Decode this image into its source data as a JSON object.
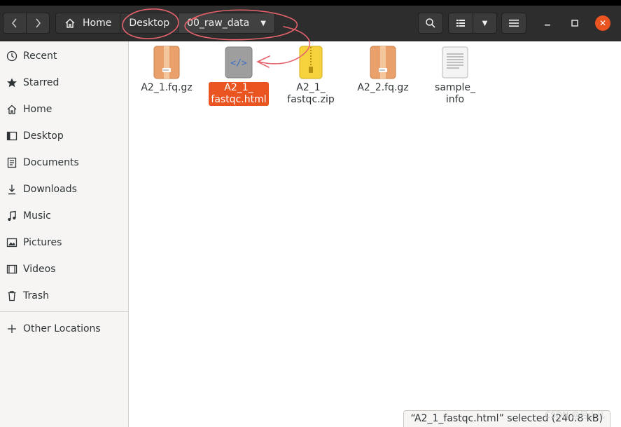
{
  "window": {
    "path": [
      {
        "label": "Home",
        "icon": "home-icon"
      },
      {
        "label": "Desktop"
      },
      {
        "label": "00_raw_data"
      }
    ]
  },
  "sidebar": {
    "items": [
      {
        "label": "Recent",
        "icon": "clock-icon"
      },
      {
        "label": "Starred",
        "icon": "star-icon"
      },
      {
        "label": "Home",
        "icon": "home-icon"
      },
      {
        "label": "Desktop",
        "icon": "desktop-icon"
      },
      {
        "label": "Documents",
        "icon": "document-icon"
      },
      {
        "label": "Downloads",
        "icon": "download-icon"
      },
      {
        "label": "Music",
        "icon": "music-icon"
      },
      {
        "label": "Pictures",
        "icon": "picture-icon"
      },
      {
        "label": "Videos",
        "icon": "video-icon"
      },
      {
        "label": "Trash",
        "icon": "trash-icon"
      }
    ],
    "other_locations": "Other Locations"
  },
  "files": [
    {
      "name": "A2_1.fq.gz",
      "icon": "archive-icon"
    },
    {
      "name": "A2_1_\nfastqc.html",
      "icon": "html-file-icon",
      "selected": true
    },
    {
      "name": "A2_1_\nfastqc.zip",
      "icon": "zip-icon"
    },
    {
      "name": "A2_2.fq.gz",
      "icon": "archive-icon"
    },
    {
      "name": "sample_\ninfo",
      "icon": "text-file-icon"
    }
  ],
  "status": "“A2_1_fastqc.html” selected (240.8 kB)",
  "watermark": "CSDN @吕小儿",
  "colors": {
    "accent": "#e95420",
    "header": "#2d2d2d",
    "annotation": "#e5626b"
  }
}
